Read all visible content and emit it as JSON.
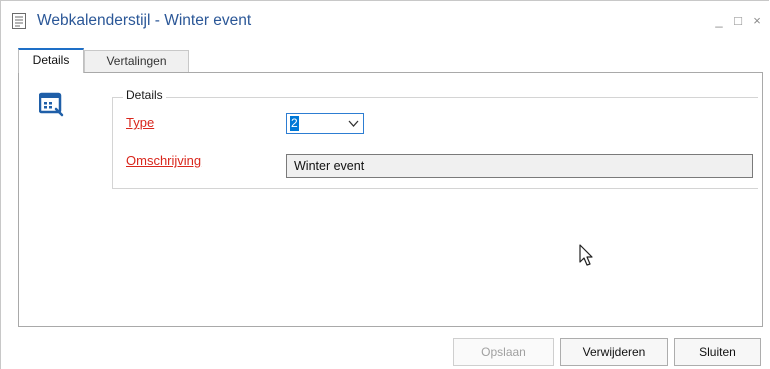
{
  "window": {
    "title": "Webkalenderstijl - Winter event",
    "controls": {
      "minimize": "_",
      "maximize": "□",
      "close": "×"
    }
  },
  "tabs": [
    {
      "label": "Details",
      "active": true
    },
    {
      "label": "Vertalingen",
      "active": false
    }
  ],
  "details_group": {
    "legend": "Details",
    "type_label": "Type",
    "type_value": "2",
    "omschrijving_label": "Omschrijving",
    "omschrijving_value": "Winter event"
  },
  "buttons": {
    "save": "Opslaan",
    "delete": "Verwijderen",
    "close": "Sluiten"
  },
  "colors": {
    "title": "#2b5797",
    "required_label": "#d9261c",
    "accent": "#1e6fc7",
    "selection": "#0078d7"
  },
  "icons": {
    "app": "document-icon",
    "form": "form-list-icon",
    "dropdown": "chevron-down-icon",
    "cursor": "mouse-pointer-icon"
  }
}
